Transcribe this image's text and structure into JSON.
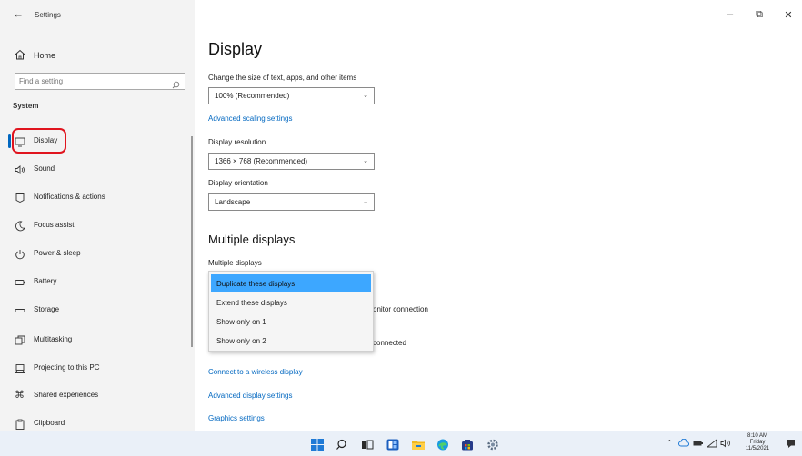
{
  "window": {
    "app_title": "Settings",
    "controls": {
      "minimize": "–",
      "restore": "⧉",
      "close": "✕"
    }
  },
  "sidebar": {
    "home_label": "Home",
    "search_placeholder": "Find a setting",
    "section": "System",
    "items": [
      {
        "label": "Display",
        "icon": "monitor-icon",
        "selected": true
      },
      {
        "label": "Sound",
        "icon": "speaker-icon"
      },
      {
        "label": "Notifications & actions",
        "icon": "notification-icon"
      },
      {
        "label": "Focus assist",
        "icon": "moon-icon"
      },
      {
        "label": "Power & sleep",
        "icon": "power-icon"
      },
      {
        "label": "Battery",
        "icon": "battery-icon"
      },
      {
        "label": "Storage",
        "icon": "storage-icon"
      },
      {
        "label": "Multitasking",
        "icon": "multitasking-icon"
      },
      {
        "label": "Projecting to this PC",
        "icon": "projecting-icon"
      },
      {
        "label": "Shared experiences",
        "icon": "shared-icon"
      },
      {
        "label": "Clipboard",
        "icon": "clipboard-icon"
      }
    ]
  },
  "main": {
    "title": "Display",
    "scale_label": "Change the size of text, apps, and other items",
    "scale_value": "100% (Recommended)",
    "advanced_scaling_link": "Advanced scaling settings",
    "resolution_label": "Display resolution",
    "resolution_value": "1366 × 768 (Recommended)",
    "orientation_label": "Display orientation",
    "orientation_value": "Landscape",
    "multiple_heading": "Multiple displays",
    "multiple_label": "Multiple displays",
    "behind_text_1": "onitor connection",
    "behind_text_2": "connected",
    "wireless_link": "Connect to a wireless display",
    "advanced_display_link": "Advanced display settings",
    "graphics_link": "Graphics settings"
  },
  "multiple_menu": {
    "options": [
      "Duplicate these displays",
      "Extend these displays",
      "Show only on 1",
      "Show only on 2"
    ],
    "highlighted_index": 0
  },
  "taskbar": {
    "apps": [
      "windows-start-icon",
      "search-icon",
      "task-view-icon",
      "widgets-icon",
      "file-explorer-icon",
      "edge-icon",
      "store-icon",
      "settings-icon"
    ],
    "clock_time": "8:10 AM",
    "clock_day": "Friday",
    "clock_date": "11/5/2021"
  },
  "colors": {
    "accent": "#0067c0",
    "highlight": "#3da7ff",
    "callout": "#e0141e",
    "sidebar_bg": "#f3f3f3"
  }
}
